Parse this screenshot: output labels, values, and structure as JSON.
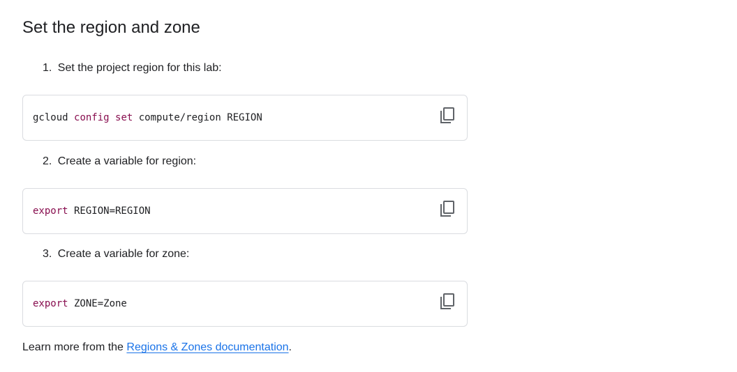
{
  "section": {
    "title": "Set the region and zone"
  },
  "steps": [
    {
      "number": "1.",
      "text": "Set the project region for this lab:",
      "code": {
        "parts": [
          {
            "text": "gcloud ",
            "kw": false
          },
          {
            "text": "config",
            "kw": true
          },
          {
            "text": " ",
            "kw": false
          },
          {
            "text": "set",
            "kw": true
          },
          {
            "text": " compute/region REGION",
            "kw": false
          }
        ]
      },
      "copy_icon": "content-copy-icon"
    },
    {
      "number": "2.",
      "text": "Create a variable for region:",
      "code": {
        "parts": [
          {
            "text": "export",
            "kw": true
          },
          {
            "text": " REGION=REGION",
            "kw": false
          }
        ]
      },
      "copy_icon": "content-copy-icon"
    },
    {
      "number": "3.",
      "text": "Create a variable for zone:",
      "code": {
        "parts": [
          {
            "text": "export",
            "kw": true
          },
          {
            "text": " ZONE=Zone",
            "kw": false
          }
        ]
      },
      "copy_icon": "content-copy-icon"
    }
  ],
  "footer": {
    "prefix": "Learn more from the ",
    "link_text": "Regions & Zones documentation",
    "suffix": "."
  },
  "colors": {
    "text": "#202124",
    "keyword": "#880e4f",
    "link": "#1a73e8",
    "border": "#dadce0",
    "icon": "#5f6368"
  }
}
